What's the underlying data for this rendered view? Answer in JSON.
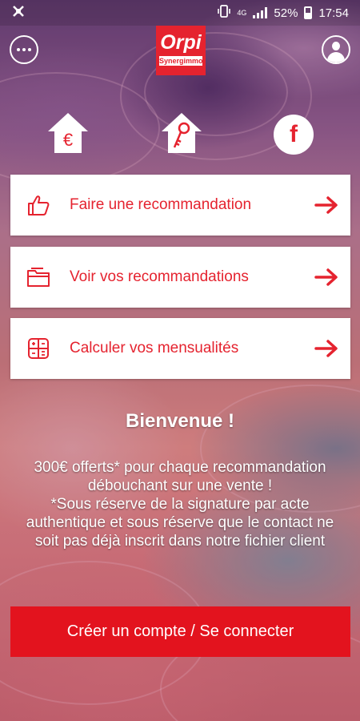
{
  "status_bar": {
    "battery_percent": "52%",
    "time": "17:54",
    "network_label": "4G",
    "icons": [
      "app-notification-icon",
      "vibrate-icon",
      "signal-icon",
      "battery-icon"
    ]
  },
  "header": {
    "logo_brand": "Orpi",
    "logo_agency": "Synergimmo",
    "menu_icon": "more-dots-icon",
    "profile_icon": "user-icon"
  },
  "quick_icons": {
    "house_euro_symbol": "€",
    "facebook_letter": "f"
  },
  "actions": [
    {
      "label": "Faire une recommandation",
      "icon": "thumbs-up-icon"
    },
    {
      "label": "Voir vos recommandations",
      "icon": "folder-icon"
    },
    {
      "label": "Calculer vos mensualités",
      "icon": "calculator-icon"
    }
  ],
  "welcome": {
    "title": "Bienvenue !",
    "offer_line1": "300€ offerts* pour chaque recommandation débouchant sur une vente !",
    "offer_line2": "*Sous réserve de la signature par acte authentique et sous réserve que le contact ne soit pas déjà inscrit dans notre fichier client"
  },
  "cta": {
    "label": "Créer un compte / Se connecter"
  },
  "colors": {
    "brand_red": "#e5232f",
    "cta_red": "#e3131e",
    "card_bg": "#ffffff"
  }
}
